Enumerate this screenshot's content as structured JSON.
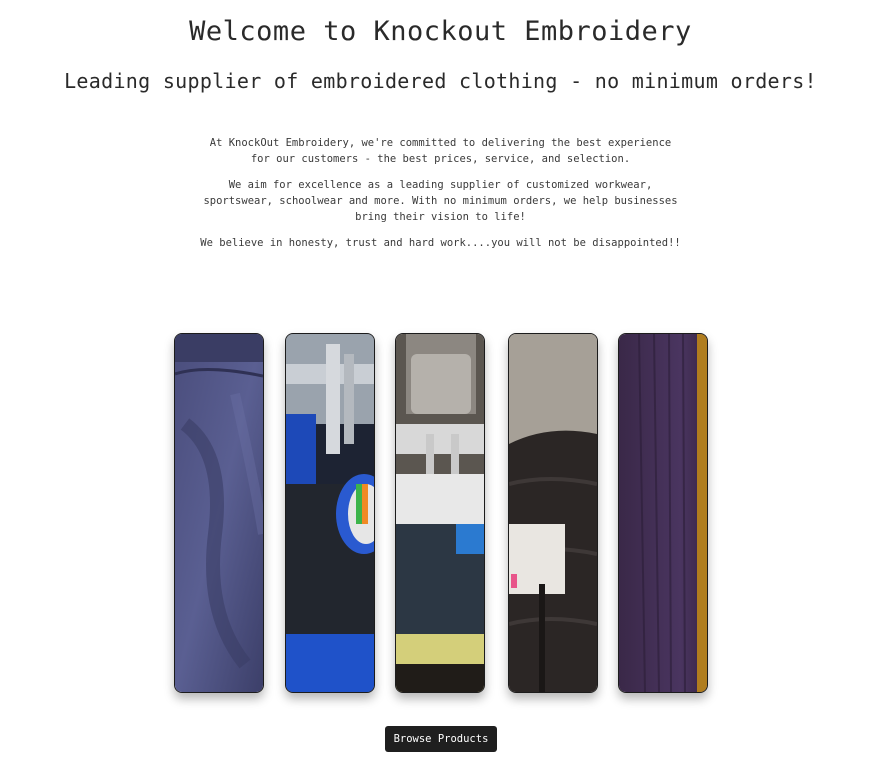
{
  "hero": {
    "title": "Welcome to Knockout Embroidery",
    "subtitle": "Leading supplier of embroidered clothing - no minimum orders!"
  },
  "intro": {
    "paragraphs": [
      "At KnockOut Embroidery, we're committed to delivering the best experience for our customers - the best prices, service, and selection.",
      "We aim for excellence as a leading supplier of customized workwear, sportswear, schoolwear and more. With no minimum orders, we help businesses bring their vision to life!",
      "We believe in honesty, trust and hard work....you will not be disappointed!!"
    ]
  },
  "gallery": {
    "images": [
      {
        "name": "navy-fabric-photo"
      },
      {
        "name": "embroidery-machine-blue-photo"
      },
      {
        "name": "embroidery-machine-needles-photo"
      },
      {
        "name": "black-puffer-jacket-photo"
      },
      {
        "name": "purple-knit-fabric-photo"
      }
    ]
  },
  "cta": {
    "browse_label": "Browse Products"
  },
  "colors": {
    "button_bg": "#1f1f1f",
    "button_text": "#ffffff",
    "text": "#2b2b2b"
  }
}
